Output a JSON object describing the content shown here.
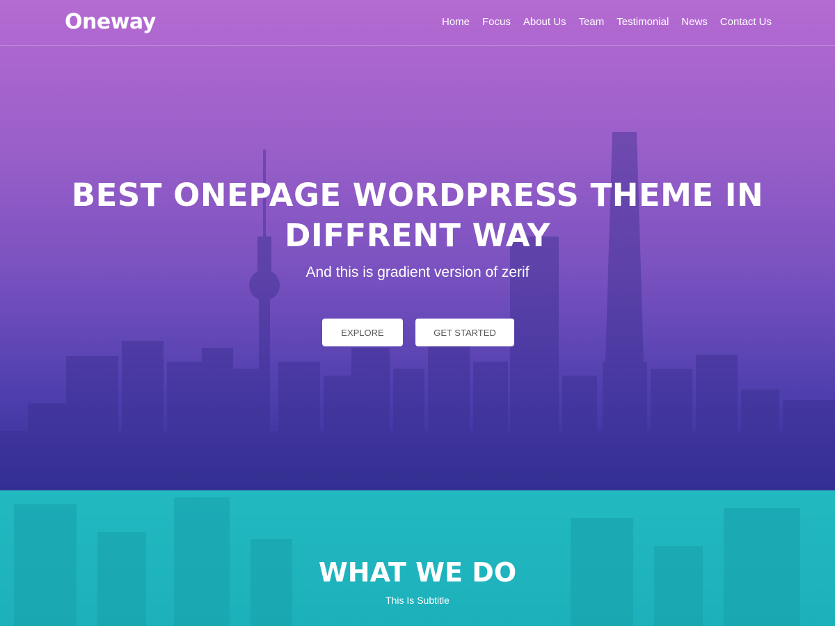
{
  "header": {
    "logo": "Oneway",
    "nav": [
      "Home",
      "Focus",
      "About Us",
      "Team",
      "Testimonial",
      "News",
      "Contact Us"
    ]
  },
  "hero": {
    "title": "BEST ONEPAGE WORDPRESS THEME IN DIFFRENT WAY",
    "subtitle": "And this is gradient version of zerif",
    "buttons": {
      "explore": "EXPLORE",
      "get_started": "GET STARTED"
    }
  },
  "section": {
    "title": "WHAT WE DO",
    "subtitle": "This Is Subtitle"
  },
  "colors": {
    "hero_top": "#b56bd2",
    "hero_bottom": "#2e2f95",
    "section_bg": "#1fb3bd",
    "button_bg": "#ffffff"
  }
}
